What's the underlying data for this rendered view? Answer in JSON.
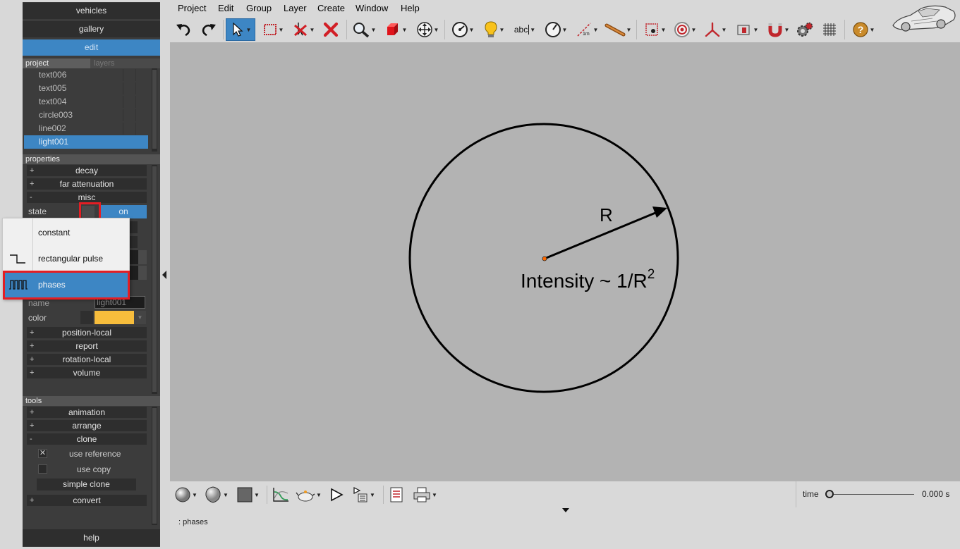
{
  "nav": {
    "vehicles": "vehicles",
    "gallery": "gallery",
    "edit": "edit",
    "help": "help"
  },
  "project_panel": {
    "tab_project": "project",
    "tab_layers": "layers",
    "items": [
      {
        "label": "text006",
        "selected": false
      },
      {
        "label": "text005",
        "selected": false
      },
      {
        "label": "text004",
        "selected": false
      },
      {
        "label": "circle003",
        "selected": false
      },
      {
        "label": "line002",
        "selected": false
      },
      {
        "label": "light001",
        "selected": true
      }
    ]
  },
  "properties": {
    "header": "properties",
    "decay": "decay",
    "far_attenuation": "far attenuation",
    "misc": "misc",
    "state_label": "state",
    "state_value": "on",
    "name_label": "name",
    "name_value": "light001",
    "color_label": "color",
    "color_value": "#f7bd3c",
    "position_local": "position-local",
    "report": "report",
    "rotation_local": "rotation-local",
    "volume": "volume",
    "plus": "+",
    "minus": "-"
  },
  "tools": {
    "header": "tools",
    "animation": "animation",
    "arrange": "arrange",
    "clone": "clone",
    "use_reference": "use reference",
    "use_copy": "use copy",
    "simple_clone": "simple clone",
    "convert": "convert",
    "checkmark": "✕"
  },
  "popup": {
    "items": [
      {
        "label": "constant",
        "icon": "none",
        "selected": false
      },
      {
        "label": "rectangular pulse",
        "icon": "rect-pulse-icon",
        "selected": false
      },
      {
        "label": "phases",
        "icon": "phases-icon",
        "selected": true
      }
    ]
  },
  "menu": [
    "Project",
    "Edit",
    "Group",
    "Layer",
    "Create",
    "Window",
    "Help"
  ],
  "toolbar": {
    "text_tool_label": "abc",
    "measure_label": "1m"
  },
  "canvas": {
    "radius_label": "R",
    "intensity_text": "Intensity ~ 1/R",
    "intensity_exponent": "2"
  },
  "bottom": {
    "time_label": "time",
    "time_value": "0.000 s",
    "time_fraction": 0.0,
    "status_text": ": phases"
  },
  "colors": {
    "accent": "#3d86c4",
    "highlight": "#e31e24",
    "light_color": "#f7bd3c"
  }
}
